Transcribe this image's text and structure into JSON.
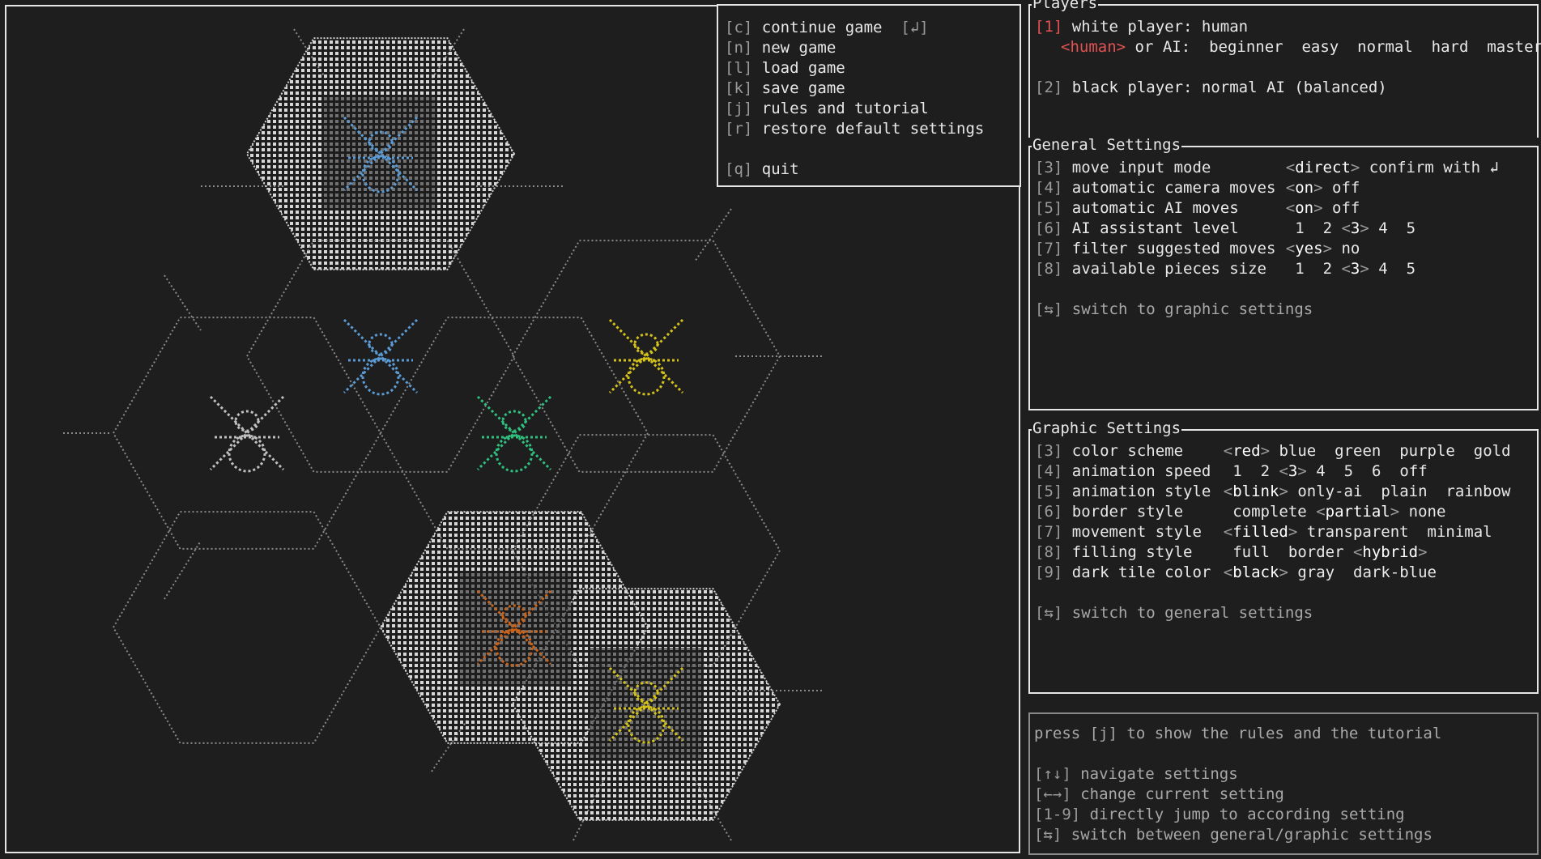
{
  "menu": {
    "items": [
      {
        "key": "[c]",
        "label": "continue game",
        "extra": "[↲]"
      },
      {
        "key": "[n]",
        "label": "new game"
      },
      {
        "key": "[l]",
        "label": "load game"
      },
      {
        "key": "[k]",
        "label": "save game"
      },
      {
        "key": "[j]",
        "label": "rules and tutorial"
      },
      {
        "key": "[r]",
        "label": "restore default settings"
      },
      {
        "key": "[q]",
        "label": "quit"
      }
    ]
  },
  "players": {
    "title": "Players",
    "white": {
      "key": "[1]",
      "text": "white player: human"
    },
    "white_options": {
      "selected": "<human>",
      "or_ai": "or AI:",
      "levels": [
        "beginner",
        "easy",
        "normal",
        "hard",
        "master"
      ]
    },
    "black": {
      "key": "[2]",
      "text": "black player: normal AI (balanced)"
    }
  },
  "general": {
    "title": "General Settings",
    "rows": [
      {
        "key": "[3]",
        "label": "move input mode",
        "options": [
          {
            "text": "<direct>",
            "selected": true
          },
          {
            "text": "confirm with ↲"
          }
        ]
      },
      {
        "key": "[4]",
        "label": "automatic camera moves",
        "options": [
          {
            "text": "<on>",
            "selected": true
          },
          {
            "text": "off"
          }
        ]
      },
      {
        "key": "[5]",
        "label": "automatic AI moves",
        "options": [
          {
            "text": "<on>",
            "selected": true
          },
          {
            "text": "off"
          }
        ]
      },
      {
        "key": "[6]",
        "label": "AI assistant level",
        "options": [
          {
            "text": " 1"
          },
          {
            "text": " 2"
          },
          {
            "text": "<3>",
            "selected": true
          },
          {
            "text": "4"
          },
          {
            "text": " 5"
          }
        ]
      },
      {
        "key": "[7]",
        "label": "filter suggested moves",
        "options": [
          {
            "text": "<yes>",
            "selected": true
          },
          {
            "text": "no"
          }
        ]
      },
      {
        "key": "[8]",
        "label": "available pieces size",
        "options": [
          {
            "text": " 1"
          },
          {
            "text": " 2"
          },
          {
            "text": "<3>",
            "selected": true
          },
          {
            "text": "4"
          },
          {
            "text": " 5"
          }
        ]
      }
    ],
    "switch": {
      "key": "[⇆]",
      "label": "switch to graphic settings"
    }
  },
  "graphic": {
    "title": "Graphic Settings",
    "rows": [
      {
        "key": "[3]",
        "label": "color scheme",
        "options": [
          {
            "text": "<red>",
            "selected": true
          },
          {
            "text": "blue"
          },
          {
            "text": " green"
          },
          {
            "text": " purple"
          },
          {
            "text": " gold"
          }
        ]
      },
      {
        "key": "[4]",
        "label": "animation speed",
        "options": [
          {
            "text": " 1"
          },
          {
            "text": " 2"
          },
          {
            "text": "<3>",
            "selected": true
          },
          {
            "text": "4"
          },
          {
            "text": " 5"
          },
          {
            "text": " 6"
          },
          {
            "text": " off"
          }
        ]
      },
      {
        "key": "[5]",
        "label": "animation style",
        "options": [
          {
            "text": "<blink>",
            "selected": true
          },
          {
            "text": "only-ai"
          },
          {
            "text": " plain"
          },
          {
            "text": " rainbow"
          }
        ]
      },
      {
        "key": "[6]",
        "label": "border style",
        "options": [
          {
            "text": " complete"
          },
          {
            "text": "<partial>",
            "selected": true
          },
          {
            "text": "none"
          }
        ]
      },
      {
        "key": "[7]",
        "label": "movement style",
        "options": [
          {
            "text": "<filled>",
            "selected": true
          },
          {
            "text": "transparent"
          },
          {
            "text": " minimal"
          }
        ]
      },
      {
        "key": "[8]",
        "label": "filling style",
        "options": [
          {
            "text": " full"
          },
          {
            "text": " border"
          },
          {
            "text": "<hybrid>",
            "selected": true
          }
        ]
      },
      {
        "key": "[9]",
        "label": "dark tile color",
        "options": [
          {
            "text": "<black>",
            "selected": true
          },
          {
            "text": "gray"
          },
          {
            "text": " dark-blue"
          }
        ]
      }
    ],
    "switch": {
      "key": "[⇆]",
      "label": "switch to general settings"
    }
  },
  "help": {
    "tip": "press [j] to show the rules and the tutorial",
    "lines": [
      {
        "key": "[↑↓]",
        "label": "navigate settings"
      },
      {
        "key": "[←→]",
        "label": "change current setting"
      },
      {
        "key": "[1-9]",
        "label": "directly jump to according setting"
      },
      {
        "key": "[⇆]",
        "label": "switch between general/graphic settings"
      }
    ]
  },
  "board": {
    "pieces": [
      {
        "name": "spider-piece",
        "color": "#5b9bd5",
        "tile": "white"
      },
      {
        "name": "spider-piece-2",
        "color": "#5b9bd5",
        "tile": "dark"
      },
      {
        "name": "ant-piece",
        "color": "#c0c0c0",
        "tile": "dark"
      },
      {
        "name": "beetle-piece",
        "color": "#2fc07f",
        "tile": "dark"
      },
      {
        "name": "queen-bee-piece",
        "color": "#d4c21a",
        "tile": "dark"
      },
      {
        "name": "spider-piece-orange",
        "color": "#c9631a",
        "tile": "white"
      },
      {
        "name": "queen-bee-piece-2",
        "color": "#d4c21a",
        "tile": "white"
      }
    ]
  }
}
